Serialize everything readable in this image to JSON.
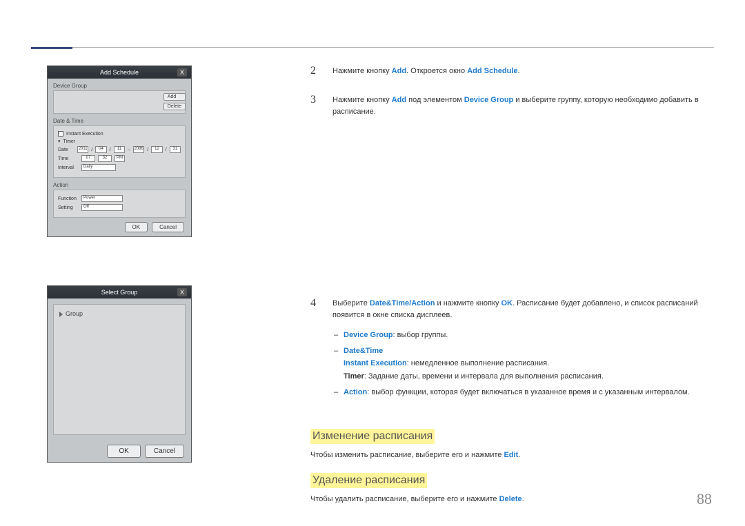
{
  "page_number": "88",
  "dialog1": {
    "title": "Add Schedule",
    "close": "X",
    "sect_device_group": "Device Group",
    "btn_add": "Add",
    "btn_delete": "Delete",
    "sect_datetime": "Date & Time",
    "instant_exec": "Instant Execution",
    "timer": "Timer",
    "row_date": "Date",
    "date_y1": "2011",
    "date_m1": "04",
    "date_d1": "11",
    "date_y2": "2086",
    "date_m2": "12",
    "date_d2": "31",
    "row_time": "Time",
    "time_h": "07",
    "time_m": "32",
    "time_ampm": "PM",
    "row_interval": "Interval",
    "interval_val": "Daily",
    "sect_action": "Action",
    "row_function": "Function",
    "function_val": "Power",
    "row_setting": "Setting",
    "setting_val": "Off",
    "ok": "OK",
    "cancel": "Cancel"
  },
  "dialog2": {
    "title": "Select Group",
    "close": "X",
    "group": "Group",
    "ok": "OK",
    "cancel": "Cancel"
  },
  "step2": {
    "num": "2",
    "t1": "Нажмите кнопку ",
    "add": "Add",
    "t2": ". Откроется окно ",
    "add_schedule": "Add Schedule",
    "t3": "."
  },
  "step3": {
    "num": "3",
    "t1": "Нажмите кнопку ",
    "add": "Add",
    "t2": " под элементом ",
    "device_group": "Device Group",
    "t3": " и выберите группу, которую необходимо добавить в расписание."
  },
  "step4": {
    "num": "4",
    "t1": "Выберите ",
    "dta": "Date&Time/Action",
    "t2": " и нажмите кнопку ",
    "ok": "OK",
    "t3": ". Расписание будет добавлено, и список расписаний появится в окне списка дисплеев.",
    "s1a": "Device Group",
    "s1b": ": выбор группы.",
    "s2a": "Date&Time",
    "s2b1": "Instant Execution",
    "s2b2": ": немедленное выполнение расписания.",
    "s2c1": "Timer",
    "s2c2": ": Задание даты, времени и интервала для выполнения расписания.",
    "s3a": "Action",
    "s3b": ": выбор функции, которая будет включаться в указанное время и с указанным интервалом."
  },
  "h_edit": "Изменение расписания",
  "p_edit1": "Чтобы изменить расписание, выберите его и нажмите ",
  "p_edit_k": "Edit",
  "p_edit2": ".",
  "h_del": "Удаление расписания",
  "p_del1": "Чтобы удалить расписание, выберите его и нажмите ",
  "p_del_k": "Delete",
  "p_del2": "."
}
